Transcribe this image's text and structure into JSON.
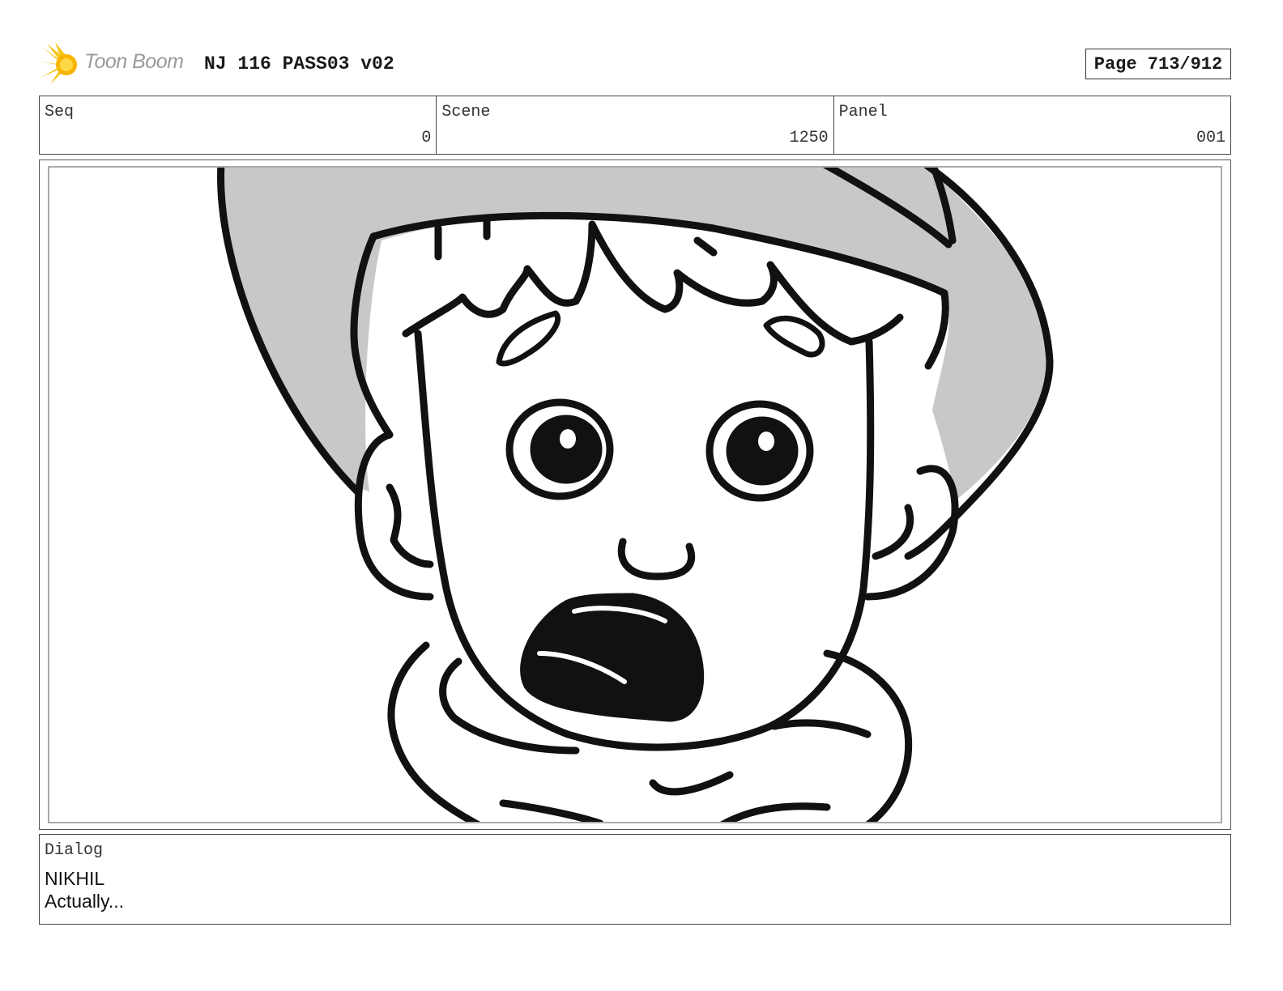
{
  "header": {
    "logo_text": "Toon Boom",
    "title": "NJ 116 PASS03 v02",
    "page": "Page 713/912"
  },
  "info": {
    "seq_label": "Seq",
    "seq_value": "0",
    "scene_label": "Scene",
    "scene_value": "1250",
    "panel_label": "Panel",
    "panel_value": "001"
  },
  "dialog": {
    "label": "Dialog",
    "character": "NIKHIL",
    "line": "Actually..."
  },
  "colors": {
    "logo_accent": "#f5c518",
    "hat_fill": "#c8c8c8",
    "ink": "#111111"
  }
}
